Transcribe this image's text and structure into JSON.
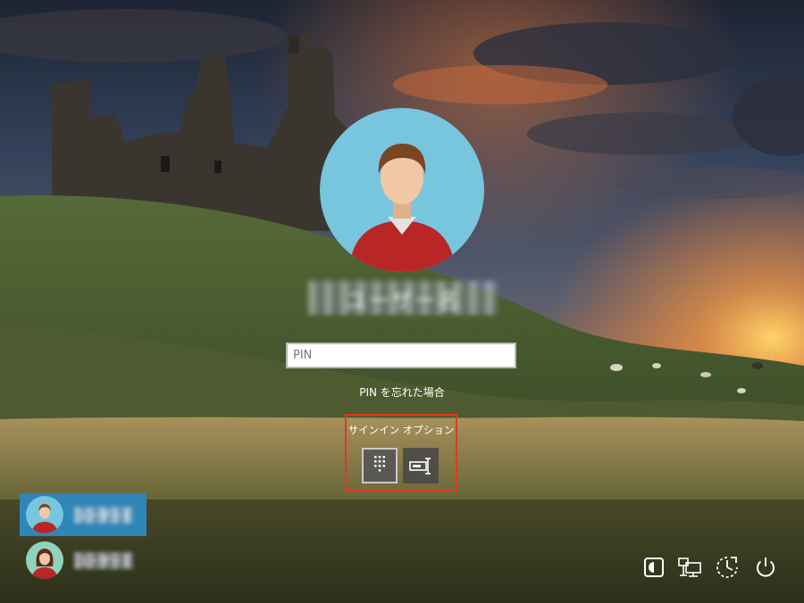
{
  "user": {
    "name": "ユーザー名"
  },
  "pin": {
    "placeholder": "PIN",
    "value": ""
  },
  "forgot_pin_link": "PIN を忘れた場合",
  "signin_options": {
    "label": "サインイン オプション",
    "options": [
      {
        "icon": "keypad-icon",
        "selected": true
      },
      {
        "icon": "password-key-icon",
        "selected": false
      }
    ]
  },
  "users": [
    {
      "name": "ユーザー1",
      "active": true
    },
    {
      "name": "ユーザー2",
      "active": false
    }
  ],
  "system_icons": [
    "ease-of-access-icon",
    "network-icon",
    "power-saver-icon",
    "power-icon"
  ],
  "colors": {
    "selection_border": "#e03b1c",
    "active_user_tile": "#2e86b9",
    "avatar_bg": "#78c5de",
    "shirt": "#b82626"
  }
}
